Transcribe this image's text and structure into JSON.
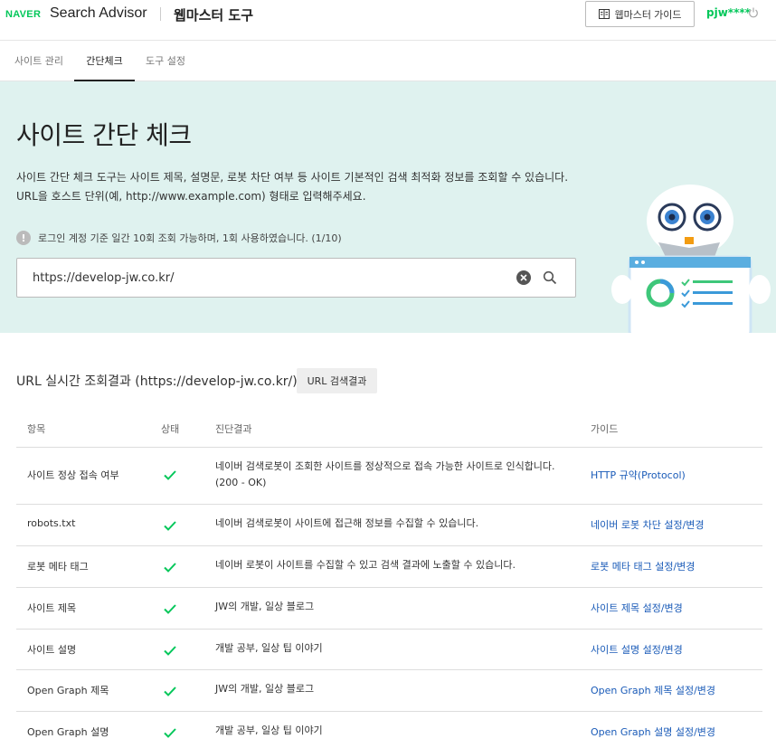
{
  "header": {
    "logo": "NAVER",
    "app_title": "Search Advisor",
    "tool_title": "웹마스터 도구",
    "guide_button": "웹마스터 가이드",
    "user": "pjw****"
  },
  "tabs": [
    {
      "label": "사이트 관리"
    },
    {
      "label": "간단체크"
    },
    {
      "label": "도구 설정"
    }
  ],
  "hero": {
    "title": "사이트 간단 체크",
    "desc_line1": "사이트 간단 체크 도구는 사이트 제목, 설명문, 로봇 차단 여부 등 사이트 기본적인 검색 최적화 정보를 조회할 수 있습니다.",
    "desc_line2": "URL을 호스트 단위(예, http://www.example.com) 형태로 입력해주세요.",
    "notice": "로그인 계정 기준 일간 10회 조회 가능하며, 1회 사용하였습니다. (1/10)",
    "notice_icon": "!",
    "search_value": "https://develop-jw.co.kr/"
  },
  "results": {
    "title": "URL 실시간 조회결과 (https://develop-jw.co.kr/)",
    "button": "URL 검색결과",
    "columns": {
      "item": "항목",
      "status": "상태",
      "result": "진단결과",
      "guide": "가이드"
    },
    "rows": [
      {
        "item": "사이트 정상 접속 여부",
        "result": "네이버 검색로봇이 조회한 사이트를 정상적으로 접속 가능한 사이트로 인식합니다. (200 - OK)",
        "guide": "HTTP 규약(Protocol)"
      },
      {
        "item": "robots.txt",
        "result": "네이버 검색로봇이 사이트에 접근해 정보를 수집할 수 있습니다.",
        "guide": "네이버 로봇 차단 설정/변경"
      },
      {
        "item": "로봇 메타 태그",
        "result": "네이버 로봇이 사이트를 수집할 수 있고 검색 결과에 노출할 수 있습니다.",
        "guide": "로봇 메타 태그 설정/변경"
      },
      {
        "item": "사이트 제목",
        "result": "JW의 개발, 일상 블로그",
        "guide": "사이트 제목 설정/변경"
      },
      {
        "item": "사이트 설명",
        "result": "개발 공부, 일상 팁 이야기",
        "guide": "사이트 설명 설정/변경"
      },
      {
        "item": "Open Graph 제목",
        "result": "JW의 개발, 일상 블로그",
        "guide": "Open Graph 제목 설정/변경"
      },
      {
        "item": "Open Graph 설명",
        "result": "개발 공부, 일상 팁 이야기",
        "guide": "Open Graph 설명 설정/변경"
      }
    ]
  },
  "colors": {
    "brand": "#03c75a",
    "hero_bg": "#dff2ef",
    "link": "#1a5bb8",
    "check": "#03c75a"
  }
}
